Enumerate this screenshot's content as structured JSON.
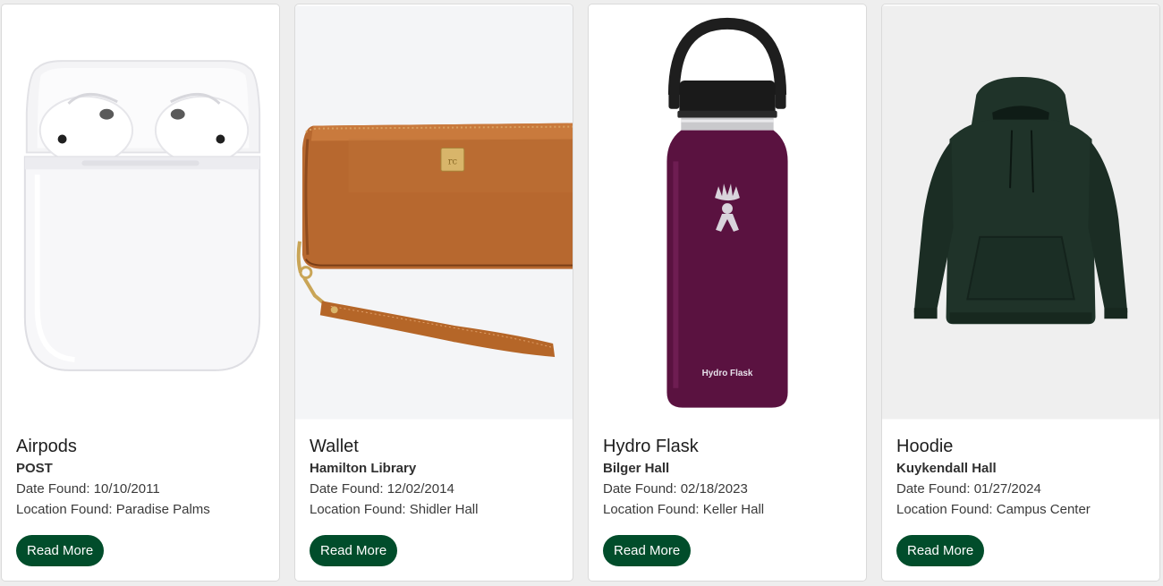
{
  "cards": [
    {
      "title": "Airpods",
      "subtitle": "POST",
      "date_line": "Date Found: 10/10/2011",
      "location_line": "Location Found: Paradise Palms",
      "button_label": "Read More",
      "image": "airpods-case"
    },
    {
      "title": "Wallet",
      "subtitle": "Hamilton Library",
      "date_line": "Date Found: 12/02/2014",
      "location_line": "Location Found: Shidler Hall",
      "button_label": "Read More",
      "image": "brown-leather-wallet"
    },
    {
      "title": "Hydro Flask",
      "subtitle": "Bilger Hall",
      "date_line": "Date Found: 02/18/2023",
      "location_line": "Location Found: Keller Hall",
      "button_label": "Read More",
      "image": "purple-water-bottle",
      "bottle_brand_text": "Hydro Flask"
    },
    {
      "title": "Hoodie",
      "subtitle": "Kuykendall Hall",
      "date_line": "Date Found: 01/27/2024",
      "location_line": "Location Found: Campus Center",
      "button_label": "Read More",
      "image": "dark-green-hoodie"
    }
  ],
  "colors": {
    "button": "#014d2b",
    "page_background": "#eeeeee",
    "card_background": "#ffffff"
  }
}
